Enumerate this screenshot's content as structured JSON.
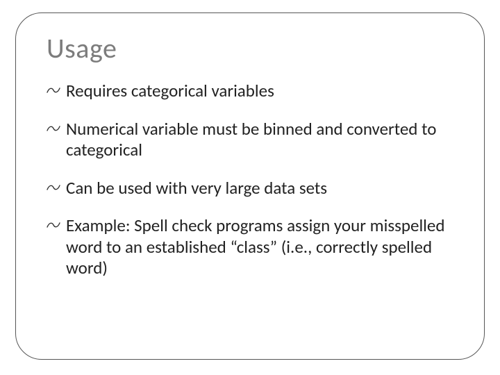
{
  "title": "Usage",
  "bullets": [
    "Requires categorical variables",
    "Numerical variable must be binned and converted to categorical",
    "Can be used with very large data sets",
    "Example:  Spell check programs assign your misspelled word to an established  “class” (i.e., correctly spelled word)"
  ]
}
